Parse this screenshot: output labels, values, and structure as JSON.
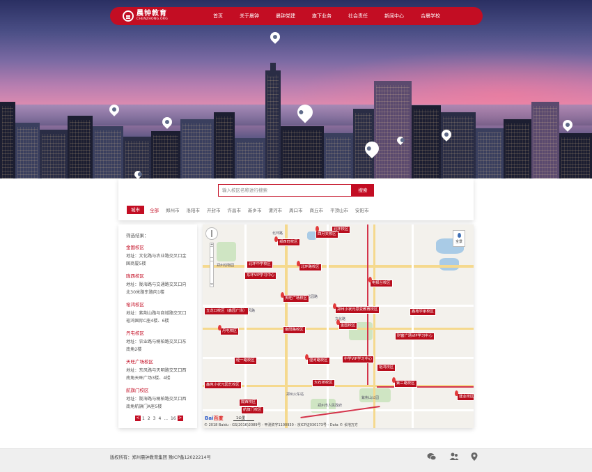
{
  "brand": {
    "name": "晨钟教育",
    "domain": "CHENZHONG.ORG"
  },
  "nav": {
    "items": [
      "首页",
      "关于晨钟",
      "晨钟党建",
      "旗下业务",
      "社会责任",
      "新闻中心",
      "合晨学校"
    ]
  },
  "search": {
    "placeholder": "输入校区名称进行搜索",
    "button": "搜索"
  },
  "cities": {
    "label": "城市",
    "items": [
      "全部",
      "郑州市",
      "洛阳市",
      "开封市",
      "许昌市",
      "新乡市",
      "漯河市",
      "周口市",
      "商丘市",
      "平顶山市",
      "安阳市"
    ]
  },
  "results": {
    "heading": "筛选结果：",
    "campuses": [
      {
        "name": "金国校区",
        "address": "地址：文化路与农业路交叉口金国商厦5楼"
      },
      {
        "name": "陇西校区",
        "address": "地址：陇海路与交通路交叉口向北30米路东路向1楼"
      },
      {
        "name": "裕鸿校区",
        "address": "地址：紫荆山路与商城路交叉口裕鸿国际C座4楼、6楼"
      },
      {
        "name": "丹屯校区",
        "address": "地址：农业路与桐柏路交叉口东南角2楼"
      },
      {
        "name": "天旺广场校区",
        "address": "地址：东风路与天明路交叉口西南角天旺广场3楼、4楼"
      },
      {
        "name": "航旗门校区",
        "address": "地址：陇海路与桐柏路交叉口西南角航旗门A座5楼"
      }
    ],
    "pager": {
      "prev": "<",
      "pages": [
        "1",
        "2",
        "3",
        "4",
        "...",
        "16"
      ],
      "next": ">"
    }
  },
  "map": {
    "labels": [
      "北环校区",
      "四月天校区",
      "郑西旺校区",
      "北环中学校区",
      "北环路校区",
      "东环VIP学习中心",
      "天旺广场校区",
      "电报台校区",
      "五龙口校区（鑫园广场）",
      "郑州小状元思变教育校区",
      "鑫苑学家校区",
      "丹屯校区",
      "南阳路校区",
      "金国校区",
      "财富广场VIP学习中心",
      "中学VIP学习中心",
      "湿河路校区",
      "经一路校区",
      "裕鸿校区",
      "鑫苑小状元园艺校区",
      "大石桥校区",
      "紫三路校区",
      "陇西校区",
      "建业校区",
      "航旗门校区"
    ],
    "place_names": [
      "北环路",
      "文化路",
      "花园路",
      "东风路",
      "郑州市人民政府",
      "郑州动物园",
      "紫荆山公园",
      "郑州火车站"
    ],
    "full_view": "全景",
    "scale": "1公里",
    "copyright": "© 2018 Baidu - GS(2016)2089号 - 甲测资字1100930 - 京ICP证030173号 - Data © 长地万方",
    "logo_left": "Bai",
    "logo_right": "百度"
  },
  "footer": {
    "text": "版权所有：郑州晨钟教育集团 豫ICP备12022214号"
  }
}
